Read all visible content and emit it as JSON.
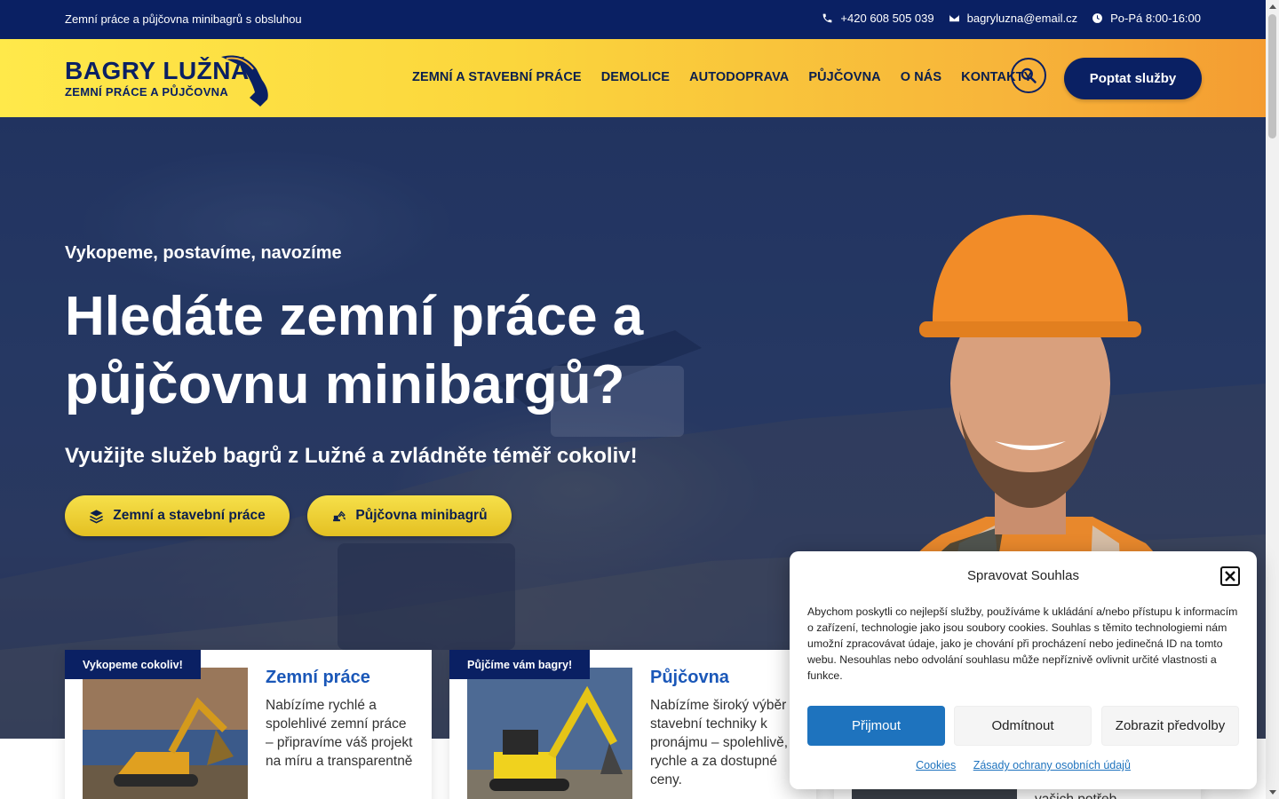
{
  "topbar": {
    "tagline": "Zemní práce a půjčovna minibagrů s obsluhou",
    "phone": "+420 608 505 039",
    "email": "bagryluzna@email.cz",
    "hours": "Po-Pá 8:00-16:00"
  },
  "header": {
    "logo_title": "BAGRY LUŽNÁ",
    "logo_subtitle": "ZEMNÍ PRÁCE A PŮJČOVNA",
    "nav": [
      "ZEMNÍ A STAVEBNÍ PRÁCE",
      "DEMOLICE",
      "AUTODOPRAVA",
      "PŮJČOVNA",
      "O NÁS",
      "KONTAKTY"
    ],
    "cta": "Poptat služby"
  },
  "hero": {
    "subtitle": "Vykopeme, postavíme, navozíme",
    "title": "Hledáte zemní práce a půjčovnu minibargů?",
    "lead": "Využijte služeb bagrů z Lužné a zvládněte téměř cokoliv!",
    "btn_earth": "Zemní a stavební práce",
    "btn_rent": "Půjčovna minibagrů"
  },
  "cards": [
    {
      "badge": "Vykopeme cokoliv!",
      "title": "Zemní práce",
      "text": "Nabízíme rychlé a spolehlivé zemní práce – připravíme váš projekt na míru a transparentně"
    },
    {
      "badge": "Půjčíme vám bagry!",
      "title": "Půjčovna",
      "text": "Nabízíme široký výběr stavební techniky k pronájmu – spolehlivě, rychle a za dostupné ceny."
    },
    {
      "text": "vašich potřeb"
    }
  ],
  "cookie": {
    "title": "Spravovat Souhlas",
    "text": "Abychom poskytli co nejlepší služby, používáme k ukládání a/nebo přístupu k informacím o zařízení, technologie jako jsou soubory cookies. Souhlas s těmito technologiemi nám umožní zpracovávat údaje, jako je chování při procházení nebo jedinečná ID na tomto webu. Nesouhlas nebo odvolání souhlasu může nepříznivě ovlivnit určité vlastnosti a funkce.",
    "accept": "Přijmout",
    "deny": "Odmítnout",
    "prefs": "Zobrazit předvolby",
    "link_cookies": "Cookies",
    "link_privacy": "Zásady ochrany osobních údajů"
  },
  "colors": {
    "navy": "#0a2063",
    "yellow": "#fbd63c",
    "orange": "#f49c31",
    "blue_link": "#1e73be",
    "card_title": "#1a57b8"
  },
  "icons": [
    "phone-icon",
    "mail-icon",
    "clock-icon",
    "search-icon",
    "layers-icon",
    "excavator-icon",
    "close-icon"
  ]
}
